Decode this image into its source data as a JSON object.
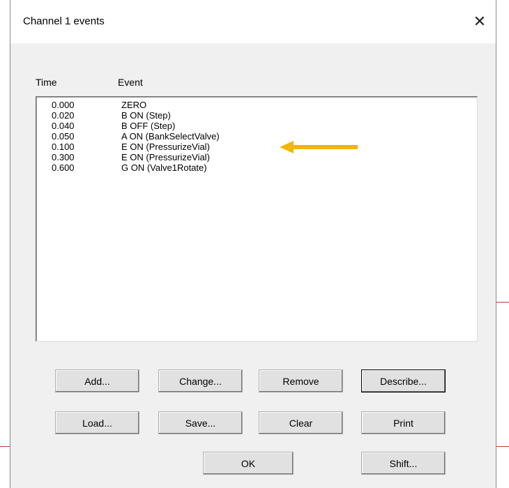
{
  "dialog": {
    "title": "Channel 1 events",
    "close_glyph": "✕"
  },
  "list": {
    "headers": {
      "time": "Time",
      "event": "Event"
    },
    "rows": [
      {
        "time": "0.000",
        "event": "ZERO"
      },
      {
        "time": "0.020",
        "event": "B ON (Step)"
      },
      {
        "time": "0.040",
        "event": "B OFF (Step)"
      },
      {
        "time": "0.050",
        "event": "A ON (BankSelectValve)"
      },
      {
        "time": "0.100",
        "event": "E ON (PressurizeVial)"
      },
      {
        "time": "0.300",
        "event": "E ON (PressurizeVial)"
      },
      {
        "time": "0.600",
        "event": "G ON (Valve1Rotate)"
      }
    ]
  },
  "buttons": {
    "add": "Add...",
    "change": "Change...",
    "remove": "Remove",
    "describe": "Describe...",
    "load": "Load...",
    "save": "Save...",
    "clear": "Clear",
    "print": "Print",
    "ok": "OK",
    "shift": "Shift..."
  },
  "annotation": {
    "icon": "left-arrow-icon",
    "color": "#f5b400"
  },
  "colors": {
    "background_line": "#c0392b"
  }
}
